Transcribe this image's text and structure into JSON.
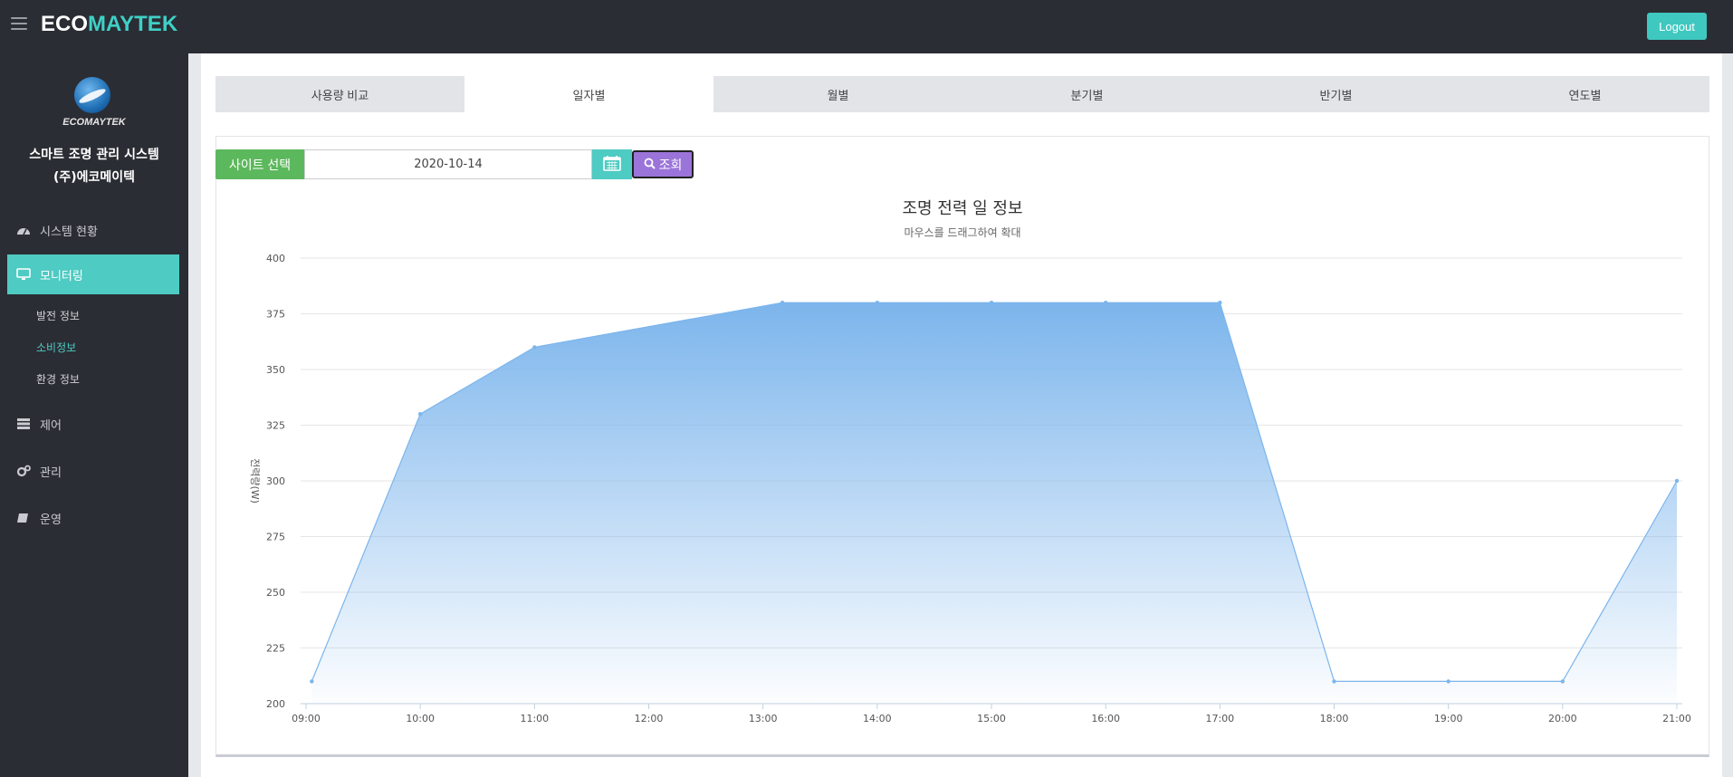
{
  "header": {
    "brand_part1": "ECO",
    "brand_part2": "MAYTEK",
    "logout_label": "Logout"
  },
  "sidebar": {
    "logo_text": "ECOMAYTEK",
    "title_line1": "스마트 조명 관리 시스템",
    "title_line2": "(주)에코메이텍",
    "items": [
      {
        "label": "시스템 현황",
        "icon": "dashboard-icon"
      },
      {
        "label": "모니터링",
        "icon": "monitor-icon",
        "active": true
      },
      {
        "label": "제어",
        "icon": "control-icon"
      },
      {
        "label": "관리",
        "icon": "gears-icon"
      },
      {
        "label": "운영",
        "icon": "book-icon"
      }
    ],
    "subitems": [
      {
        "label": "발전 정보"
      },
      {
        "label": "소비정보",
        "active": true
      },
      {
        "label": "환경 정보"
      }
    ]
  },
  "tabs": [
    {
      "label": "사용량 비교"
    },
    {
      "label": "일자별",
      "active": true
    },
    {
      "label": "월별"
    },
    {
      "label": "분기별"
    },
    {
      "label": "반기별"
    },
    {
      "label": "연도별"
    }
  ],
  "controls": {
    "site_label": "사이트 선택",
    "date_value": "2020-10-14",
    "search_label": "조회"
  },
  "colors": {
    "accent": "#4ecbc2",
    "series": "#7cb5ec",
    "site_button": "#5cb85c",
    "search_button": "#9b74d9"
  },
  "chart_data": {
    "type": "area",
    "title": "조명 전력 일 정보",
    "subtitle": "마우스를 드래그하여 확대",
    "ylabel": "전력량(W)",
    "xlabel": "",
    "ylim": [
      200,
      400
    ],
    "yticks": [
      200,
      225,
      250,
      275,
      300,
      325,
      350,
      375,
      400
    ],
    "xticks": [
      "09:00",
      "10:00",
      "11:00",
      "12:00",
      "13:00",
      "14:00",
      "15:00",
      "16:00",
      "17:00",
      "18:00",
      "19:00",
      "20:00",
      "21:00"
    ],
    "grid": true,
    "points": [
      {
        "x": 9.05,
        "y": 210
      },
      {
        "x": 10.0,
        "y": 330
      },
      {
        "x": 11.0,
        "y": 360
      },
      {
        "x": 13.17,
        "y": 380
      },
      {
        "x": 14.0,
        "y": 380
      },
      {
        "x": 15.0,
        "y": 380
      },
      {
        "x": 16.0,
        "y": 380
      },
      {
        "x": 17.0,
        "y": 380
      },
      {
        "x": 18.0,
        "y": 210
      },
      {
        "x": 19.0,
        "y": 210
      },
      {
        "x": 20.0,
        "y": 210
      },
      {
        "x": 21.0,
        "y": 300
      }
    ]
  }
}
